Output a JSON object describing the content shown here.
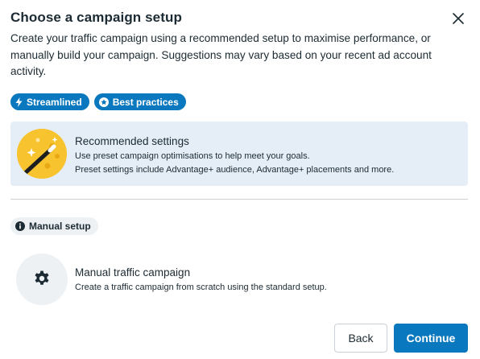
{
  "dialog": {
    "title": "Choose a campaign setup",
    "description": "Create your traffic campaign using a recommended setup to maximise performance, or manually build your campaign. Suggestions may vary based on your recent ad account activity.",
    "close_icon": "close-icon"
  },
  "chips": [
    {
      "label": "Streamlined",
      "icon": "lightning-icon"
    },
    {
      "label": "Best practices",
      "icon": "star-icon"
    }
  ],
  "recommended": {
    "title": "Recommended settings",
    "line1": "Use preset campaign optimisations to help meet your goals.",
    "line2": "Preset settings include Advantage+ audience, Advantage+ placements and more.",
    "icon": "magic-wand-icon"
  },
  "manual_badge": {
    "label": "Manual setup",
    "icon": "info-icon"
  },
  "manual": {
    "title": "Manual traffic campaign",
    "subtitle": "Create a traffic campaign from scratch using the standard setup.",
    "icon": "gear-icon"
  },
  "buttons": {
    "back": "Back",
    "continue": "Continue"
  },
  "colors": {
    "primary": "#0a78be",
    "card_bg": "#e5eef7",
    "badge_bg": "#eef1f4",
    "wand_bg": "#f7c32e"
  }
}
